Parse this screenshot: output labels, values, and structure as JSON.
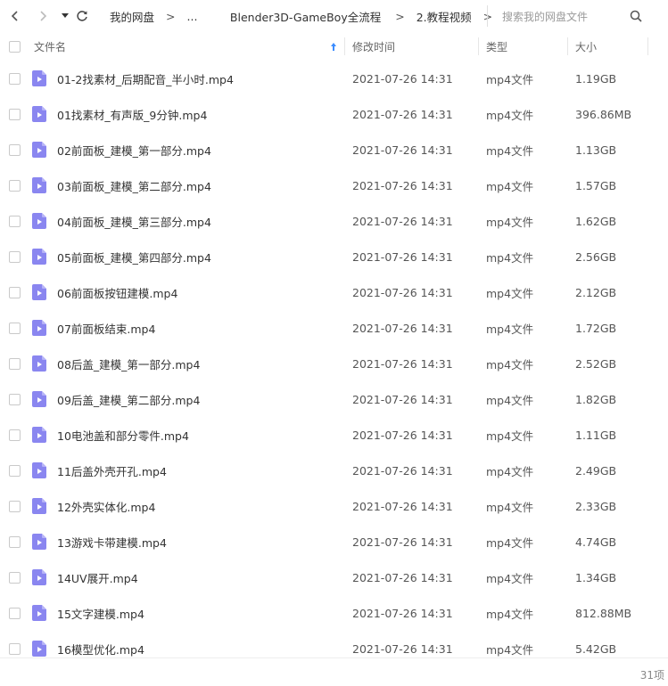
{
  "nav": {
    "back_icon": "chevron-left-icon",
    "forward_icon": "chevron-right-icon",
    "history_icon": "caret-down-icon",
    "refresh_icon": "refresh-icon"
  },
  "breadcrumb": {
    "items": [
      "我的网盘",
      "...",
      "Blender3D-GameBoy全流程",
      "2.教程视频"
    ],
    "separator": ">"
  },
  "search": {
    "placeholder": "搜索我的网盘文件",
    "icon": "search-icon"
  },
  "table": {
    "headers": {
      "name": "文件名",
      "modified": "修改时间",
      "type": "类型",
      "size": "大小"
    },
    "sort_icon": "sort-up-arrow-icon",
    "rows": [
      {
        "name": "01-2找素材_后期配音_半小时.mp4",
        "modified": "2021-07-26 14:31",
        "type": "mp4文件",
        "size": "1.19GB"
      },
      {
        "name": "01找素材_有声版_9分钟.mp4",
        "modified": "2021-07-26 14:31",
        "type": "mp4文件",
        "size": "396.86MB"
      },
      {
        "name": "02前面板_建模_第一部分.mp4",
        "modified": "2021-07-26 14:31",
        "type": "mp4文件",
        "size": "1.13GB"
      },
      {
        "name": "03前面板_建模_第二部分.mp4",
        "modified": "2021-07-26 14:31",
        "type": "mp4文件",
        "size": "1.57GB"
      },
      {
        "name": "04前面板_建模_第三部分.mp4",
        "modified": "2021-07-26 14:31",
        "type": "mp4文件",
        "size": "1.62GB"
      },
      {
        "name": "05前面板_建模_第四部分.mp4",
        "modified": "2021-07-26 14:31",
        "type": "mp4文件",
        "size": "2.56GB"
      },
      {
        "name": "06前面板按钮建模.mp4",
        "modified": "2021-07-26 14:31",
        "type": "mp4文件",
        "size": "2.12GB"
      },
      {
        "name": "07前面板结束.mp4",
        "modified": "2021-07-26 14:31",
        "type": "mp4文件",
        "size": "1.72GB"
      },
      {
        "name": "08后盖_建模_第一部分.mp4",
        "modified": "2021-07-26 14:31",
        "type": "mp4文件",
        "size": "2.52GB"
      },
      {
        "name": "09后盖_建模_第二部分.mp4",
        "modified": "2021-07-26 14:31",
        "type": "mp4文件",
        "size": "1.82GB"
      },
      {
        "name": "10电池盖和部分零件.mp4",
        "modified": "2021-07-26 14:31",
        "type": "mp4文件",
        "size": "1.11GB"
      },
      {
        "name": "11后盖外壳开孔.mp4",
        "modified": "2021-07-26 14:31",
        "type": "mp4文件",
        "size": "2.49GB"
      },
      {
        "name": "12外壳实体化.mp4",
        "modified": "2021-07-26 14:31",
        "type": "mp4文件",
        "size": "2.33GB"
      },
      {
        "name": "13游戏卡带建模.mp4",
        "modified": "2021-07-26 14:31",
        "type": "mp4文件",
        "size": "4.74GB"
      },
      {
        "name": "14UV展开.mp4",
        "modified": "2021-07-26 14:31",
        "type": "mp4文件",
        "size": "1.34GB"
      },
      {
        "name": "15文字建模.mp4",
        "modified": "2021-07-26 14:31",
        "type": "mp4文件",
        "size": "812.88MB"
      },
      {
        "name": "16模型优化.mp4",
        "modified": "2021-07-26 14:31",
        "type": "mp4文件",
        "size": "5.42GB"
      }
    ]
  },
  "footer": {
    "count": "31项"
  },
  "colors": {
    "video_icon": "#8a86f0",
    "text": "#333333",
    "muted": "#666666",
    "sort_arrow": "#3b8cff"
  }
}
